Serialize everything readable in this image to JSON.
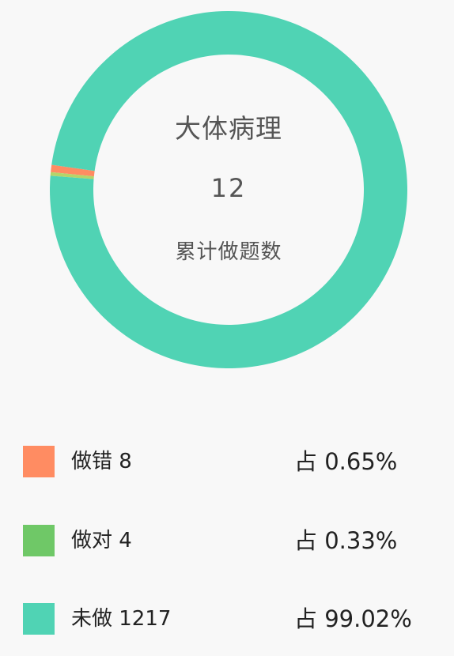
{
  "center": {
    "title": "大体病理",
    "count": "12",
    "caption": "累计做题数"
  },
  "legend": [
    {
      "label": "做错 8",
      "percent": "占 0.65%",
      "color": "#ff8c62"
    },
    {
      "label": "做对 4",
      "percent": "占 0.33%",
      "color": "#6fc867"
    },
    {
      "label": "未做 1217",
      "percent": "占 99.02%",
      "color": "#50d3b4"
    }
  ],
  "chart_data": {
    "type": "pie",
    "categories": [
      "做错",
      "做对",
      "未做"
    ],
    "values": [
      8,
      4,
      1217
    ],
    "percentages": [
      0.65,
      0.33,
      99.02
    ],
    "colors": [
      "#ff8c62",
      "#b5d46a",
      "#50d3b4"
    ]
  }
}
